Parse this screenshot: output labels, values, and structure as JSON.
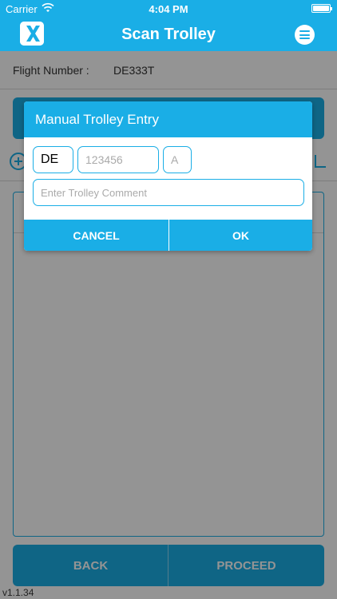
{
  "status_bar": {
    "carrier": "Carrier",
    "time": "4:04 PM",
    "wifi_icon": "wifi-icon",
    "battery_icon": "battery-icon",
    "battery_level": 1.0
  },
  "nav": {
    "title": "Scan Trolley",
    "logo_icon": "x-logo-icon",
    "menu_icon": "hamburger-menu-icon"
  },
  "flight": {
    "label": "Flight Number :",
    "value": "DE333T"
  },
  "footer": {
    "back_label": "BACK",
    "proceed_label": "PROCEED",
    "version": "v1.1.34"
  },
  "dialog": {
    "title": "Manual Trolley Entry",
    "prefix_value": "DE",
    "number_placeholder": "123456",
    "suffix_placeholder": "A",
    "comment_placeholder": "Enter Trolley Comment",
    "cancel_label": "CANCEL",
    "ok_label": "OK"
  },
  "colors": {
    "accent": "#1aaee6",
    "overlay": "rgba(0,0,0,0.42)"
  }
}
